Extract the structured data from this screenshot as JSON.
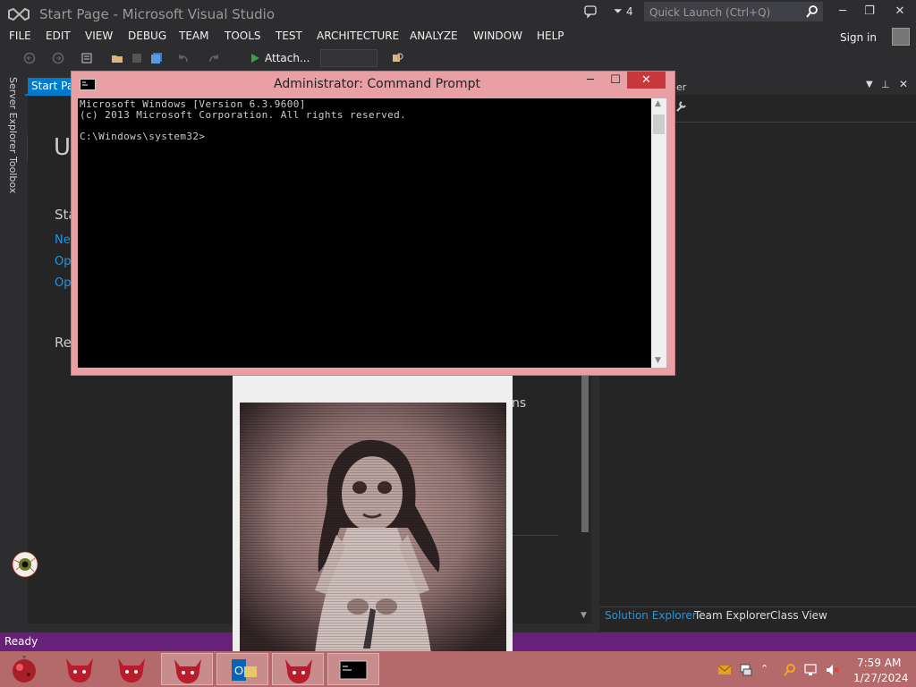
{
  "window": {
    "title": "Start Page - Microsoft Visual Studio",
    "notification_count": "4",
    "quick_launch_placeholder": "Quick Launch (Ctrl+Q)",
    "controls": {
      "minimize": "─",
      "restore": "❐",
      "close": "✕"
    }
  },
  "menu": [
    "FILE",
    "EDIT",
    "VIEW",
    "DEBUG",
    "TEAM",
    "TOOLS",
    "TEST",
    "ARCHITECTURE",
    "ANALYZE",
    "WINDOW",
    "HELP"
  ],
  "sign_in": "Sign in",
  "toolbar": {
    "attach_label": "Attach...",
    "attach_icon": "play-icon"
  },
  "side_tabs": [
    "Server Explorer",
    "Toolbox"
  ],
  "document": {
    "tab_label": "Start Page",
    "heading_fragment": "U",
    "start_fragment": "Sta",
    "links": [
      "Ne",
      "Op",
      "Op"
    ],
    "recent_fragment": "Re",
    "hidden_fragment": "ns"
  },
  "right_panel": {
    "title_fragment": "er",
    "tabs": [
      "Solution Explorer",
      "Team Explorer",
      "Class View"
    ],
    "active_tab": "Solution Explorer"
  },
  "status": {
    "text": "Ready"
  },
  "cmd": {
    "title": "Administrator: Command Prompt",
    "lines": [
      "Microsoft Windows [Version 6.3.9600]",
      "(c) 2013 Microsoft Corporation. All rights reserved.",
      "",
      "C:\\Windows\\system32>"
    ],
    "controls": {
      "minimize": "─",
      "maximize": "☐",
      "close": "✕"
    }
  },
  "taskbar": {
    "time": "7:59 AM",
    "date": "1/27/2024",
    "buttons": [
      "start-orb",
      "demon-app",
      "demon-app",
      "demon-app",
      "outlook-app",
      "demon-app",
      "cmd-app"
    ]
  },
  "colors": {
    "vs_bg": "#2d2d30",
    "accent": "#007acc",
    "status_bar": "#68217a",
    "taskbar": "#b46a6a",
    "cmd_frame": "#e8a0a5",
    "cmd_close": "#c7383d"
  }
}
